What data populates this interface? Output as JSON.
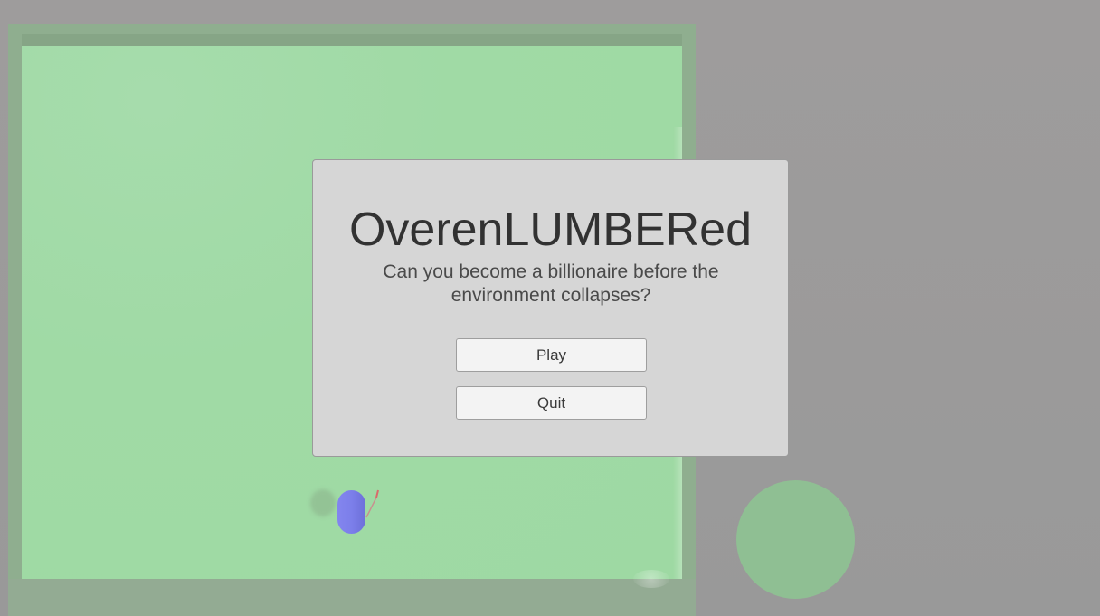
{
  "menu": {
    "title": "OverenLUMBERed",
    "subtitle": "Can you become a billionaire before the environment collapses?",
    "buttons": {
      "play_label": "Play",
      "quit_label": "Quit"
    }
  },
  "colors": {
    "background": "#999999",
    "ground": "#a0daa5",
    "ground_border": "#8fae8f",
    "player": "#7c7fea",
    "circle_object": "#8fbf93",
    "panel": "#d6d6d6",
    "button": "#f3f3f3"
  }
}
